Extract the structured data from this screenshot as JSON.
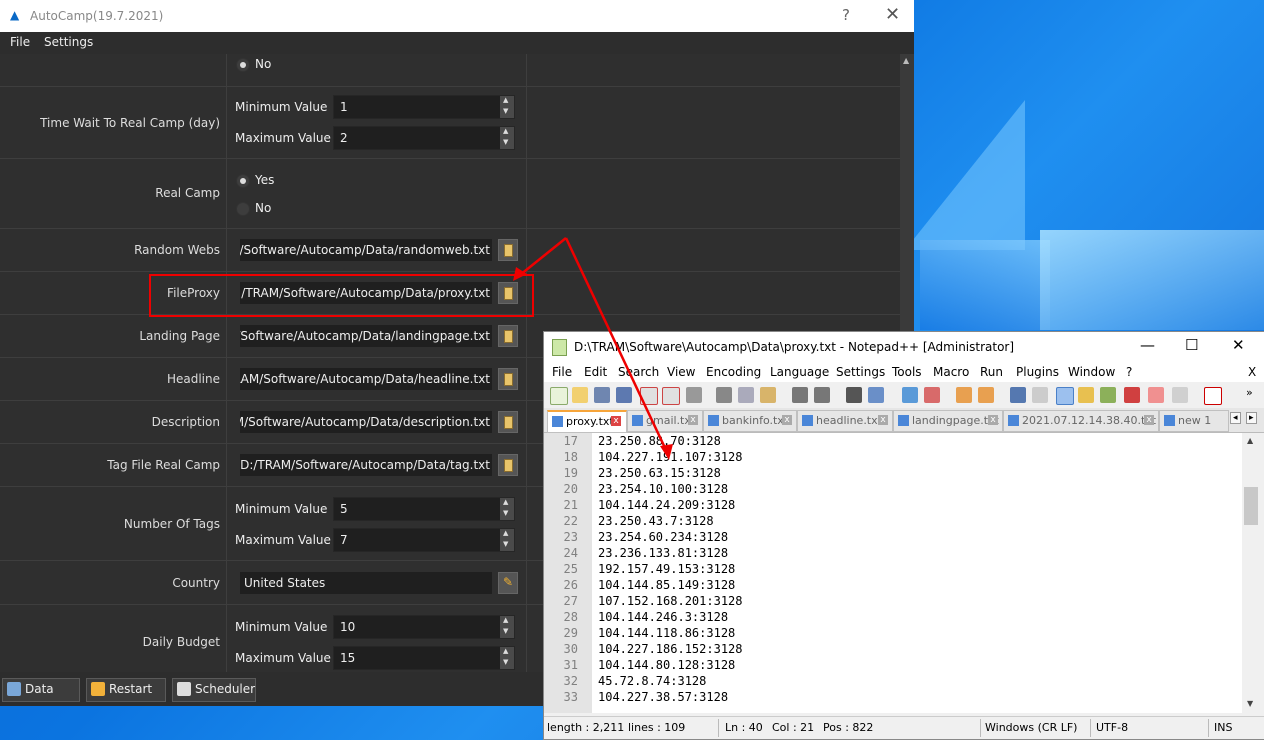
{
  "autocamp": {
    "title": "AutoCamp(19.7.2021)",
    "help": "?",
    "close": "✕",
    "menu": [
      "File",
      "Settings"
    ],
    "rows": {
      "top_no": "No",
      "time_wait": {
        "label": "Time Wait To Real Camp (day)",
        "min_label": "Minimum Value",
        "min": "1",
        "max_label": "Maximum Value",
        "max": "2"
      },
      "real_camp": {
        "label": "Real Camp",
        "yes": "Yes",
        "no": "No"
      },
      "random_webs": {
        "label": "Random Webs",
        "path": "M/Software/Autocamp/Data/randomweb.txt"
      },
      "fileproxy": {
        "label": "FileProxy",
        "path": ":/TRAM/Software/Autocamp/Data/proxy.txt"
      },
      "landing_page": {
        "label": "Landing Page",
        "path": "M/Software/Autocamp/Data/landingpage.txt"
      },
      "headline": {
        "label": "Headline",
        "path": "RAM/Software/Autocamp/Data/headline.txt"
      },
      "description": {
        "label": "Description",
        "path": "AM/Software/Autocamp/Data/description.txt"
      },
      "tag_file": {
        "label": "Tag File Real Camp",
        "path": "D:/TRAM/Software/Autocamp/Data/tag.txt"
      },
      "num_tags": {
        "label": "Number Of Tags",
        "min_label": "Minimum Value",
        "min": "5",
        "max_label": "Maximum Value",
        "max": "7"
      },
      "country": {
        "label": "Country",
        "value": "United States"
      },
      "daily_budget": {
        "label": "Daily Budget",
        "min_label": "Minimum Value",
        "min": "10",
        "max_label": "Maximum Value",
        "max": "15"
      }
    },
    "footer": {
      "data": "Data",
      "restart": "Restart",
      "scheduler": "Scheduler"
    }
  },
  "notepad": {
    "title": "D:\\TRAM\\Software\\Autocamp\\Data\\proxy.txt - Notepad++ [Administrator]",
    "controls": {
      "min": "—",
      "max": "☐",
      "close": "✕"
    },
    "menu": [
      "File",
      "Edit",
      "Search",
      "View",
      "Encoding",
      "Language",
      "Settings",
      "Tools",
      "Macro",
      "Run",
      "Plugins",
      "Window",
      "?"
    ],
    "menu_close": "X",
    "tabs": [
      "proxy.txt",
      "gmail.txt",
      "bankinfo.txt",
      "headline.txt",
      "landingpage.txt",
      "2021.07.12.14.38.40.txt",
      "new 1"
    ],
    "lines": [
      {
        "n": "17",
        "t": "23.250.88.70:3128"
      },
      {
        "n": "18",
        "t": "104.227.191.107:3128"
      },
      {
        "n": "19",
        "t": "23.250.63.15:3128"
      },
      {
        "n": "20",
        "t": "23.254.10.100:3128"
      },
      {
        "n": "21",
        "t": "104.144.24.209:3128"
      },
      {
        "n": "22",
        "t": "23.250.43.7:3128"
      },
      {
        "n": "23",
        "t": "23.254.60.234:3128"
      },
      {
        "n": "24",
        "t": "23.236.133.81:3128"
      },
      {
        "n": "25",
        "t": "192.157.49.153:3128"
      },
      {
        "n": "26",
        "t": "104.144.85.149:3128"
      },
      {
        "n": "27",
        "t": "107.152.168.201:3128"
      },
      {
        "n": "28",
        "t": "104.144.246.3:3128"
      },
      {
        "n": "29",
        "t": "104.144.118.86:3128"
      },
      {
        "n": "30",
        "t": "104.227.186.152:3128"
      },
      {
        "n": "31",
        "t": "104.144.80.128:3128"
      },
      {
        "n": "32",
        "t": "45.72.8.74:3128"
      },
      {
        "n": "33",
        "t": "104.227.38.57:3128"
      }
    ],
    "status": {
      "length": "length : 2,211",
      "lines": "lines : 109",
      "ln": "Ln : 40",
      "col": "Col : 21",
      "pos": "Pos : 822",
      "eol": "Windows (CR LF)",
      "enc": "UTF-8",
      "ins": "INS"
    }
  },
  "colors": {
    "dark_bg": "#2d2d2d",
    "highlight_red": "#e00000",
    "desktop_blue": "#0b74e0"
  }
}
